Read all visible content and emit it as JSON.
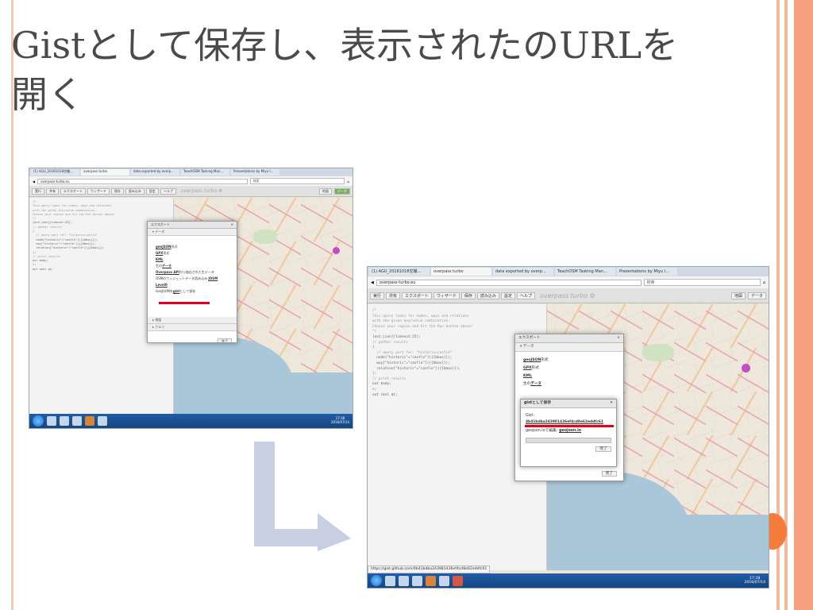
{
  "slide": {
    "title_line1": "Gistとして保存し、表示されたのURLを",
    "title_line2": "開く"
  },
  "browser": {
    "tabs": [
      "(1) AGU_20161018空撮...",
      "overpass turbo",
      "data exported by overp...",
      "TeachOSM Tasking Man...",
      "Presentations by Miyu I..."
    ],
    "url": "overpass-turbo.eu",
    "search_placeholder": "検索"
  },
  "toolbar": {
    "buttons": [
      "実行",
      "共有",
      "エクスポート",
      "ウィザード",
      "保存",
      "読み込み",
      "設定",
      "ヘルプ"
    ],
    "brand": "overpass turbo ⚙",
    "right": [
      "地図",
      "データ"
    ]
  },
  "editor": {
    "lines": [
      "/*",
      "This query looks for nodes, ways and relations",
      "with the given key/value combination.",
      "Choose your region and hit the Run button above!",
      "*/",
      "[out:json][timeout:25];",
      "// gather results",
      "(",
      "  // query part for: “historic=castle”",
      "  node[\"historic\"=\"castle\"]({{bbox}});",
      "  way[\"historic\"=\"castle\"]({{bbox}});",
      "  relation[\"historic\"=\"castle\"]({{bbox}});",
      ");",
      "// print results",
      "out body;",
      ">;",
      "out skel qt;"
    ]
  },
  "export_dialog": {
    "title": "エクスポート",
    "section_data": "▾ データ",
    "items": [
      {
        "name": "geoJSON",
        "suffix": "形式"
      },
      {
        "name": "GPX",
        "suffix": "形式"
      },
      {
        "name": "KML",
        "suffix": ""
      },
      {
        "name": "",
        "prefix": "生の",
        "underlined": "データ"
      }
    ],
    "api_item": "Overpass API",
    "api_suffix": "から抽出された生データ",
    "osm_item": "OSMのウィジェットデータ読み込み",
    "josm_item": "JOSM",
    "level0_item": "Level0",
    "gist_prefix": "GeoJSONを",
    "gist_link": "gist",
    "gist_suffix": "として保存",
    "section_map": "▸ 地図",
    "section_query": "▸ クエリ",
    "close_label": "完了"
  },
  "gist_dialog": {
    "title": "gistとして保存",
    "label": "Gist:",
    "gist_id": "4b41bdba243981436ef4cd8e62eddfc61",
    "geojson_prefix": "geojson.ioで編集:",
    "geojson_link": "geojson.io",
    "close_label": "完了"
  },
  "status_url": "https://gist.github.com/4b41bdba243981436ef4cd8e62eddfc61",
  "taskbar": {
    "time": "17:38",
    "date": "2016/07/14"
  },
  "colors": {
    "highlight_red": "#e0001b",
    "slide_accent": "#f4a07c",
    "arrow": "#c9cfe3"
  }
}
